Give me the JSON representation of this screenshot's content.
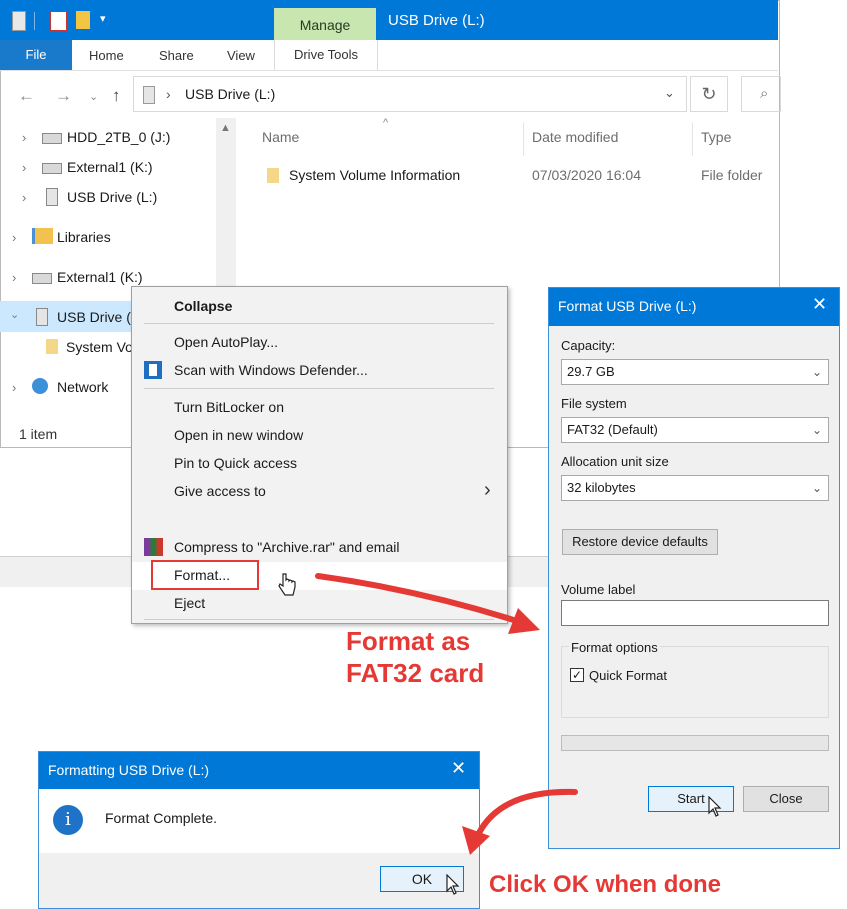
{
  "explorer": {
    "manage_tab": "Manage",
    "window_title": "USB Drive (L:)",
    "ribbon_tabs": [
      "File",
      "Home",
      "Share",
      "View",
      "Drive Tools"
    ],
    "address": "USB Drive (L:)",
    "tree": [
      "HDD_2TB_0 (J:)",
      "External1 (K:)",
      "USB Drive (L:)",
      "Libraries",
      "External1 (K:)",
      "USB Drive (L:)",
      "System Volume Information",
      "Network"
    ],
    "tree_cut": {
      "usb_drive": "USB Drive (",
      "system_vol": "System Vo"
    },
    "columns": {
      "name": "Name",
      "date": "Date modified",
      "type": "Type"
    },
    "rows": [
      {
        "name": "System Volume Information",
        "date": "07/03/2020 16:04",
        "type": "File folder"
      }
    ],
    "status": "1 item"
  },
  "context_menu": {
    "collapse": "Collapse",
    "open_autoplay": "Open AutoPlay...",
    "scan_defender": "Scan with Windows Defender...",
    "bitlocker": "Turn BitLocker on",
    "new_window": "Open in new window",
    "pin_quick": "Pin to Quick access",
    "give_access": "Give access to",
    "compress": "Compress to \"Archive.rar\" and email",
    "format": "Format...",
    "eject": "Eject"
  },
  "format_dialog": {
    "title": "Format USB Drive (L:)",
    "capacity_label": "Capacity:",
    "capacity_value": "29.7 GB",
    "filesystem_label": "File system",
    "filesystem_value": "FAT32 (Default)",
    "alloc_label": "Allocation unit size",
    "alloc_value": "32 kilobytes",
    "restore_button": "Restore device defaults",
    "volume_label": "Volume label",
    "volume_value": "",
    "options_label": "Format options",
    "quick_format": "Quick Format",
    "quick_format_checked": true,
    "start_button": "Start",
    "close_button": "Close"
  },
  "done_dialog": {
    "title": "Formatting USB Drive (L:)",
    "message": "Format Complete.",
    "ok_button": "OK"
  },
  "annotations": {
    "callout_format_line1": "Format as",
    "callout_format_line2": "FAT32 card",
    "callout_ok": "Click OK when done"
  },
  "colors": {
    "accent": "#0078d7",
    "annotation": "#e53935",
    "manage_tab": "#c7e6b0"
  }
}
